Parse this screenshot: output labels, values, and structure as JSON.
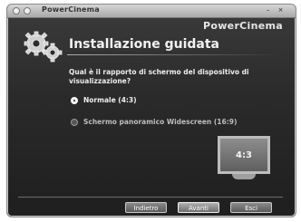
{
  "window": {
    "title": "PowerCinema"
  },
  "header": {
    "brand": "PowerCinema",
    "title": "Installazione guidata"
  },
  "question": "Qual è il rapporto di schermo del dispositivo di visualizzazione?",
  "options": [
    {
      "label": "Normale (4:3)",
      "checked": true
    },
    {
      "label": "Schermo panoramico Widescreen (16:9)",
      "checked": false
    }
  ],
  "preview": {
    "label": "4:3"
  },
  "buttons": {
    "back": "Indietro",
    "next": "Avanti",
    "exit": "Esci"
  },
  "colors": {
    "background": "#2a2a2a",
    "text": "#f2f2f2"
  }
}
